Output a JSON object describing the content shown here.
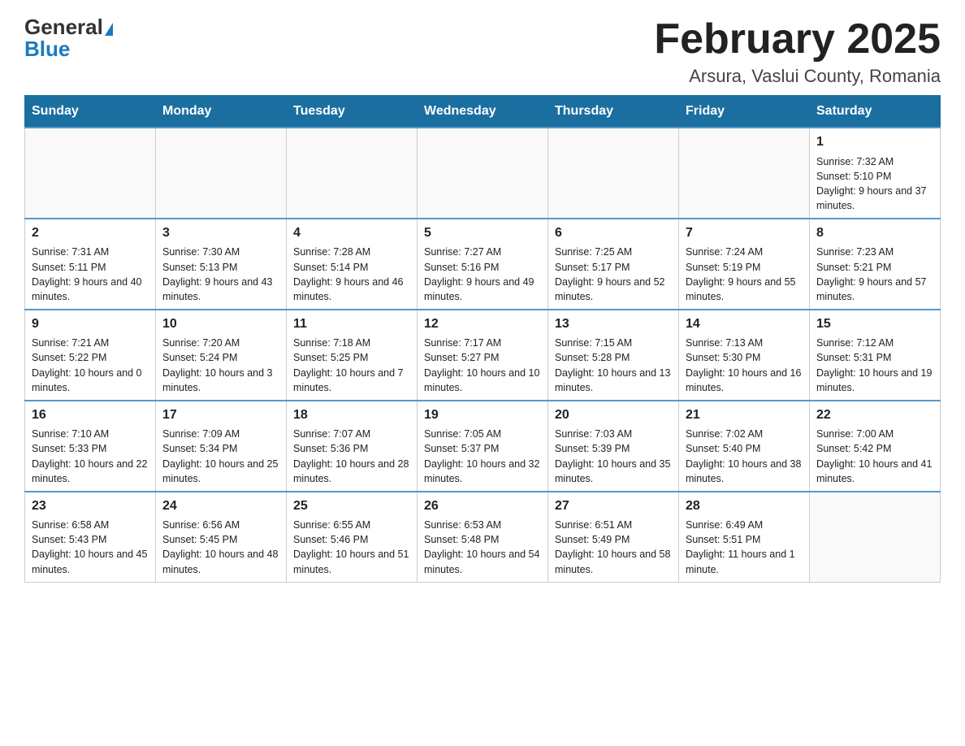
{
  "header": {
    "logo_general": "General",
    "logo_blue": "Blue",
    "month_title": "February 2025",
    "location": "Arsura, Vaslui County, Romania"
  },
  "weekdays": [
    "Sunday",
    "Monday",
    "Tuesday",
    "Wednesday",
    "Thursday",
    "Friday",
    "Saturday"
  ],
  "weeks": [
    [
      {
        "day": "",
        "info": ""
      },
      {
        "day": "",
        "info": ""
      },
      {
        "day": "",
        "info": ""
      },
      {
        "day": "",
        "info": ""
      },
      {
        "day": "",
        "info": ""
      },
      {
        "day": "",
        "info": ""
      },
      {
        "day": "1",
        "info": "Sunrise: 7:32 AM\nSunset: 5:10 PM\nDaylight: 9 hours and 37 minutes."
      }
    ],
    [
      {
        "day": "2",
        "info": "Sunrise: 7:31 AM\nSunset: 5:11 PM\nDaylight: 9 hours and 40 minutes."
      },
      {
        "day": "3",
        "info": "Sunrise: 7:30 AM\nSunset: 5:13 PM\nDaylight: 9 hours and 43 minutes."
      },
      {
        "day": "4",
        "info": "Sunrise: 7:28 AM\nSunset: 5:14 PM\nDaylight: 9 hours and 46 minutes."
      },
      {
        "day": "5",
        "info": "Sunrise: 7:27 AM\nSunset: 5:16 PM\nDaylight: 9 hours and 49 minutes."
      },
      {
        "day": "6",
        "info": "Sunrise: 7:25 AM\nSunset: 5:17 PM\nDaylight: 9 hours and 52 minutes."
      },
      {
        "day": "7",
        "info": "Sunrise: 7:24 AM\nSunset: 5:19 PM\nDaylight: 9 hours and 55 minutes."
      },
      {
        "day": "8",
        "info": "Sunrise: 7:23 AM\nSunset: 5:21 PM\nDaylight: 9 hours and 57 minutes."
      }
    ],
    [
      {
        "day": "9",
        "info": "Sunrise: 7:21 AM\nSunset: 5:22 PM\nDaylight: 10 hours and 0 minutes."
      },
      {
        "day": "10",
        "info": "Sunrise: 7:20 AM\nSunset: 5:24 PM\nDaylight: 10 hours and 3 minutes."
      },
      {
        "day": "11",
        "info": "Sunrise: 7:18 AM\nSunset: 5:25 PM\nDaylight: 10 hours and 7 minutes."
      },
      {
        "day": "12",
        "info": "Sunrise: 7:17 AM\nSunset: 5:27 PM\nDaylight: 10 hours and 10 minutes."
      },
      {
        "day": "13",
        "info": "Sunrise: 7:15 AM\nSunset: 5:28 PM\nDaylight: 10 hours and 13 minutes."
      },
      {
        "day": "14",
        "info": "Sunrise: 7:13 AM\nSunset: 5:30 PM\nDaylight: 10 hours and 16 minutes."
      },
      {
        "day": "15",
        "info": "Sunrise: 7:12 AM\nSunset: 5:31 PM\nDaylight: 10 hours and 19 minutes."
      }
    ],
    [
      {
        "day": "16",
        "info": "Sunrise: 7:10 AM\nSunset: 5:33 PM\nDaylight: 10 hours and 22 minutes."
      },
      {
        "day": "17",
        "info": "Sunrise: 7:09 AM\nSunset: 5:34 PM\nDaylight: 10 hours and 25 minutes."
      },
      {
        "day": "18",
        "info": "Sunrise: 7:07 AM\nSunset: 5:36 PM\nDaylight: 10 hours and 28 minutes."
      },
      {
        "day": "19",
        "info": "Sunrise: 7:05 AM\nSunset: 5:37 PM\nDaylight: 10 hours and 32 minutes."
      },
      {
        "day": "20",
        "info": "Sunrise: 7:03 AM\nSunset: 5:39 PM\nDaylight: 10 hours and 35 minutes."
      },
      {
        "day": "21",
        "info": "Sunrise: 7:02 AM\nSunset: 5:40 PM\nDaylight: 10 hours and 38 minutes."
      },
      {
        "day": "22",
        "info": "Sunrise: 7:00 AM\nSunset: 5:42 PM\nDaylight: 10 hours and 41 minutes."
      }
    ],
    [
      {
        "day": "23",
        "info": "Sunrise: 6:58 AM\nSunset: 5:43 PM\nDaylight: 10 hours and 45 minutes."
      },
      {
        "day": "24",
        "info": "Sunrise: 6:56 AM\nSunset: 5:45 PM\nDaylight: 10 hours and 48 minutes."
      },
      {
        "day": "25",
        "info": "Sunrise: 6:55 AM\nSunset: 5:46 PM\nDaylight: 10 hours and 51 minutes."
      },
      {
        "day": "26",
        "info": "Sunrise: 6:53 AM\nSunset: 5:48 PM\nDaylight: 10 hours and 54 minutes."
      },
      {
        "day": "27",
        "info": "Sunrise: 6:51 AM\nSunset: 5:49 PM\nDaylight: 10 hours and 58 minutes."
      },
      {
        "day": "28",
        "info": "Sunrise: 6:49 AM\nSunset: 5:51 PM\nDaylight: 11 hours and 1 minute."
      },
      {
        "day": "",
        "info": ""
      }
    ]
  ]
}
